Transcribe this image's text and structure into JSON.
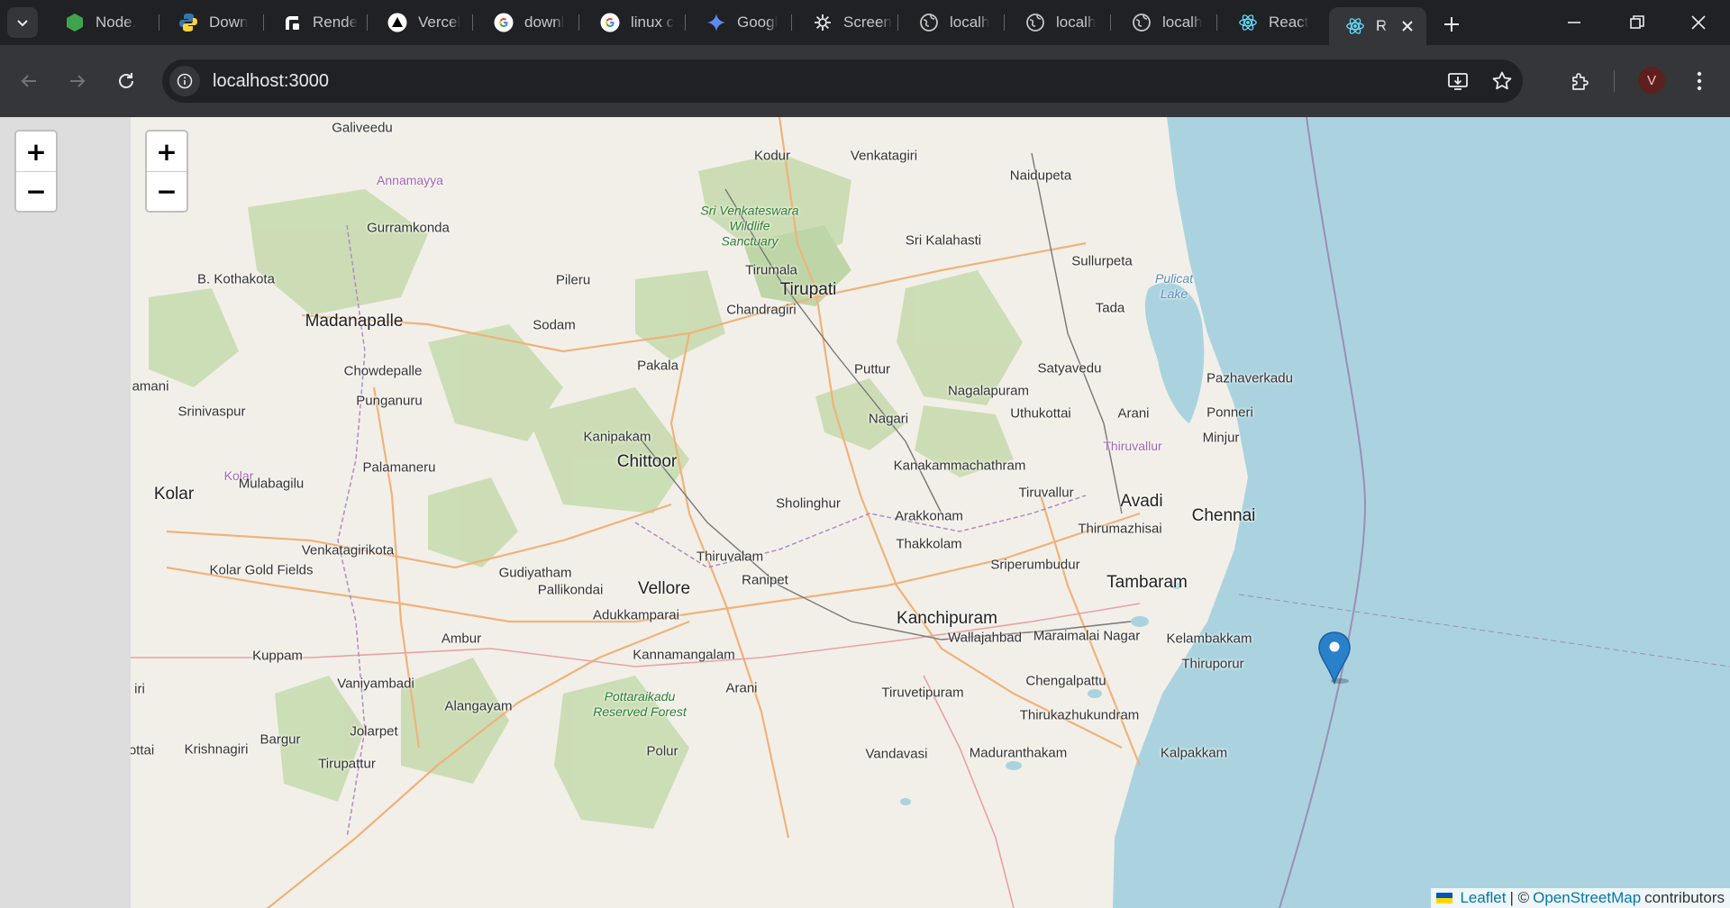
{
  "tabs": [
    {
      "title": "Node.",
      "icon": "nodejs-icon"
    },
    {
      "title": "Down",
      "icon": "python-icon"
    },
    {
      "title": "Rende",
      "icon": "render-icon"
    },
    {
      "title": "Vercel",
      "icon": "vercel-icon"
    },
    {
      "title": "downl",
      "icon": "google-icon"
    },
    {
      "title": "linux c",
      "icon": "google-icon"
    },
    {
      "title": "Googl",
      "icon": "gemini-icon"
    },
    {
      "title": "Screen",
      "icon": "screen-icon"
    },
    {
      "title": "localh",
      "icon": "globe-icon"
    },
    {
      "title": "localh",
      "icon": "globe-icon"
    },
    {
      "title": "localh",
      "icon": "globe-icon"
    },
    {
      "title": "React",
      "icon": "react-icon"
    }
  ],
  "active_tab": {
    "title": "R",
    "icon": "react-icon"
  },
  "address_bar": {
    "url": "localhost:3000"
  },
  "profile": {
    "initial": "V"
  },
  "map": {
    "zoom_in": "+",
    "zoom_out": "−",
    "places": [
      {
        "name": "Galiveedu",
        "kind": "town"
      },
      {
        "name": "Annamayya",
        "kind": "district"
      },
      {
        "name": "Kodur",
        "kind": "town"
      },
      {
        "name": "Venkatagiri",
        "kind": "town"
      },
      {
        "name": "Naidupeta",
        "kind": "town"
      },
      {
        "name": "Gurramkonda",
        "kind": "town"
      },
      {
        "name": "Sri Venkateswara Wildlife Sanctuary",
        "kind": "green"
      },
      {
        "name": "Sri Kalahasti",
        "kind": "town"
      },
      {
        "name": "Sullurpeta",
        "kind": "town"
      },
      {
        "name": "Pulicat Lake",
        "kind": "lake"
      },
      {
        "name": "B. Kothakota",
        "kind": "town"
      },
      {
        "name": "Pileru",
        "kind": "town"
      },
      {
        "name": "Tirumala",
        "kind": "town"
      },
      {
        "name": "Tirupati",
        "kind": "city"
      },
      {
        "name": "Madanapalle",
        "kind": "city"
      },
      {
        "name": "Sodam",
        "kind": "town"
      },
      {
        "name": "Chandragiri",
        "kind": "town"
      },
      {
        "name": "Tada",
        "kind": "town"
      },
      {
        "name": "Chowdepalle",
        "kind": "town"
      },
      {
        "name": "Pakala",
        "kind": "town"
      },
      {
        "name": "Puttur",
        "kind": "town"
      },
      {
        "name": "Satyavedu",
        "kind": "town"
      },
      {
        "name": "Pazhaverkadu",
        "kind": "town"
      },
      {
        "name": "amani",
        "kind": "town"
      },
      {
        "name": "Nagalapuram",
        "kind": "town"
      },
      {
        "name": "Srinivaspur",
        "kind": "town"
      },
      {
        "name": "Punganuru",
        "kind": "town"
      },
      {
        "name": "Uthukottai",
        "kind": "town"
      },
      {
        "name": "Arani",
        "kind": "town"
      },
      {
        "name": "Ponneri",
        "kind": "town"
      },
      {
        "name": "Nagari",
        "kind": "town"
      },
      {
        "name": "Kanipakam",
        "kind": "town"
      },
      {
        "name": "Minjur",
        "kind": "town"
      },
      {
        "name": "Thiruvallur",
        "kind": "district"
      },
      {
        "name": "Chittoor",
        "kind": "city"
      },
      {
        "name": "Kolar",
        "kind": "district"
      },
      {
        "name": "Palamaneru",
        "kind": "town"
      },
      {
        "name": "Kanakammachathram",
        "kind": "town"
      },
      {
        "name": "Mulabagilu",
        "kind": "town"
      },
      {
        "name": "Kolar",
        "kind": "city"
      },
      {
        "name": "Tiruvallur",
        "kind": "town"
      },
      {
        "name": "Avadi",
        "kind": "big"
      },
      {
        "name": "Sholinghur",
        "kind": "town"
      },
      {
        "name": "Chennai",
        "kind": "big"
      },
      {
        "name": "Arakkonam",
        "kind": "town"
      },
      {
        "name": "Thirumazhisai",
        "kind": "town"
      },
      {
        "name": "Venkatagirikota",
        "kind": "town"
      },
      {
        "name": "Thakkolam",
        "kind": "town"
      },
      {
        "name": "Thiruvalam",
        "kind": "town"
      },
      {
        "name": "Kolar Gold Fields",
        "kind": "town"
      },
      {
        "name": "Sriperumbudur",
        "kind": "town"
      },
      {
        "name": "Gudiyatham",
        "kind": "town"
      },
      {
        "name": "Ranipet",
        "kind": "town"
      },
      {
        "name": "Tambaram",
        "kind": "big"
      },
      {
        "name": "Pallikondai",
        "kind": "town"
      },
      {
        "name": "Vellore",
        "kind": "city"
      },
      {
        "name": "Kanchipuram",
        "kind": "city"
      },
      {
        "name": "Adukkamparai",
        "kind": "town"
      },
      {
        "name": "Maraimalai Nagar",
        "kind": "town"
      },
      {
        "name": "Wallajahbad",
        "kind": "town"
      },
      {
        "name": "Kelambakkam",
        "kind": "town"
      },
      {
        "name": "Ambur",
        "kind": "town"
      },
      {
        "name": "Kannamangalam",
        "kind": "town"
      },
      {
        "name": "Kuppam",
        "kind": "town"
      },
      {
        "name": "Thiruporur",
        "kind": "town"
      },
      {
        "name": "Chengalpattu",
        "kind": "town"
      },
      {
        "name": "Vaniyambadi",
        "kind": "town"
      },
      {
        "name": "Arani",
        "kind": "town"
      },
      {
        "name": "iri",
        "kind": "town"
      },
      {
        "name": "Tiruvetipuram",
        "kind": "town"
      },
      {
        "name": "Pottaraikadu Reserved Forest",
        "kind": "green"
      },
      {
        "name": "Alangayam",
        "kind": "town"
      },
      {
        "name": "Thirukazhukundram",
        "kind": "town"
      },
      {
        "name": "Jolarpet",
        "kind": "town"
      },
      {
        "name": "Bargur",
        "kind": "town"
      },
      {
        "name": "Krishnagiri",
        "kind": "town"
      },
      {
        "name": "ottai",
        "kind": "town"
      },
      {
        "name": "Polur",
        "kind": "town"
      },
      {
        "name": "Vandavasi",
        "kind": "town"
      },
      {
        "name": "Maduranthakam",
        "kind": "town"
      },
      {
        "name": "Kalpakkam",
        "kind": "town"
      },
      {
        "name": "Tirupattur",
        "kind": "town"
      }
    ],
    "attribution": {
      "leaflet": "Leaflet",
      "separator": "| ©",
      "osm": "OpenStreetMap",
      "suffix": "contributors"
    }
  }
}
